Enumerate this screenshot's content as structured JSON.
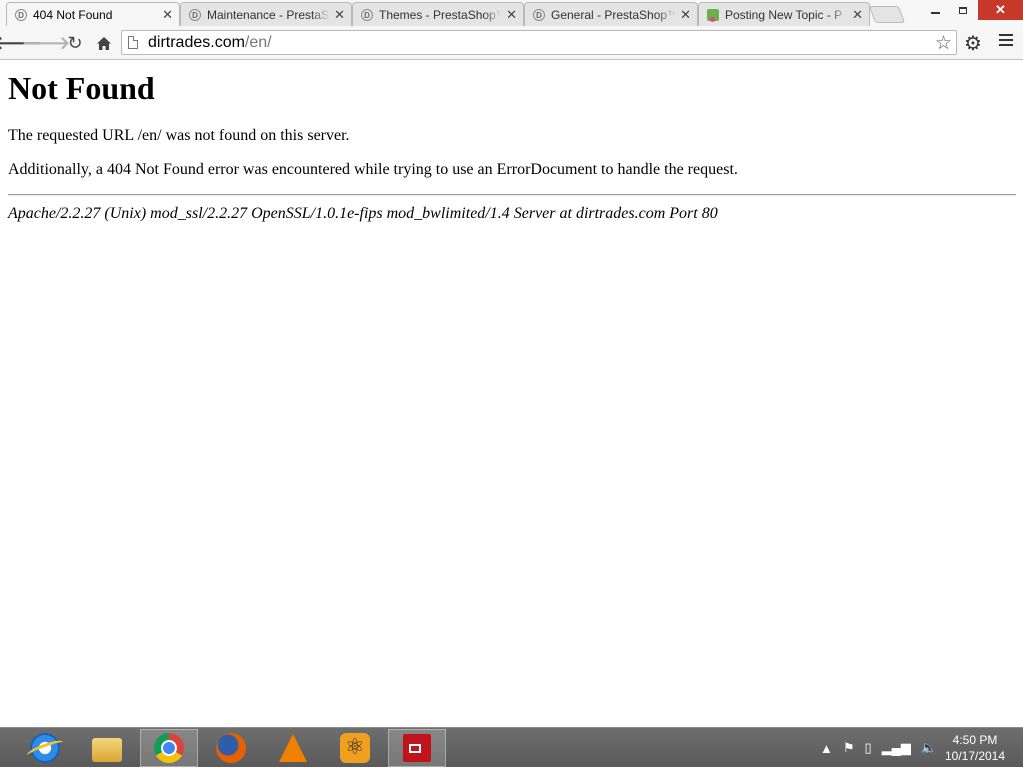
{
  "browser": {
    "tabs": [
      {
        "title": "404 Not Found",
        "favicon": "d-circle-icon",
        "active": true
      },
      {
        "title": "Maintenance - PrestaShop",
        "favicon": "d-circle-icon",
        "active": false
      },
      {
        "title": "Themes - PrestaShop™",
        "favicon": "d-circle-icon",
        "active": false
      },
      {
        "title": "General - PrestaShop™",
        "favicon": "d-circle-icon",
        "active": false
      },
      {
        "title": "Posting New Topic - P",
        "favicon": "leaf-icon",
        "active": false
      }
    ],
    "tab_close_glyph": "✕",
    "favicon_letter": "D",
    "url_host": "dirtrades.com",
    "url_path": "/en/"
  },
  "page": {
    "heading": "Not Found",
    "paragraph1": "The requested URL /en/ was not found on this server.",
    "paragraph2": "Additionally, a 404 Not Found error was encountered while trying to use an ErrorDocument to handle the request.",
    "address": "Apache/2.2.27 (Unix) mod_ssl/2.2.27 OpenSSL/1.0.1e-fips mod_bwlimited/1.4 Server at dirtrades.com Port 80"
  },
  "taskbar": {
    "apps": [
      "internet-explorer",
      "file-explorer",
      "chrome",
      "firefox",
      "vlc",
      "atom-app",
      "red-app"
    ],
    "clock_time": "4:50 PM",
    "clock_date": "10/17/2014"
  },
  "colors": {
    "close_button": "#c7382b",
    "taskbar": "#5a5a5a"
  }
}
